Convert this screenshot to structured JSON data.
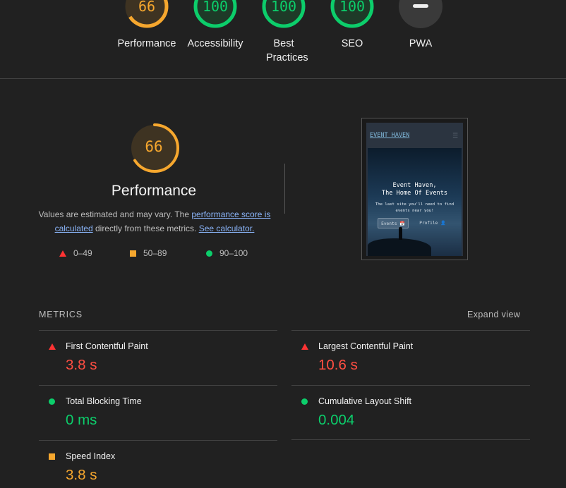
{
  "top_scores": [
    {
      "label": "Performance",
      "score": "66",
      "score_fraction": 0.66,
      "color": "#f6a72e",
      "track": "#3e3322"
    },
    {
      "label": "Accessibility",
      "score": "100",
      "score_fraction": 1.0,
      "color": "#0cce6b",
      "track": "#1e3a28"
    },
    {
      "label": "Best Practices",
      "score": "100",
      "score_fraction": 1.0,
      "color": "#0cce6b",
      "track": "#1e3a28"
    },
    {
      "label": "SEO",
      "score": "100",
      "score_fraction": 1.0,
      "color": "#0cce6b",
      "track": "#1e3a28"
    },
    {
      "label": "PWA",
      "score": "",
      "score_fraction": 0,
      "color": "#3a3a3a",
      "track": "#3a3a3a"
    }
  ],
  "performance": {
    "score": "66",
    "score_fraction": 0.66,
    "title": "Performance",
    "desc_prefix": "Values are estimated and may vary. The ",
    "desc_link1": "performance score is calculated",
    "desc_middle": " directly from these metrics. ",
    "desc_link2": "See calculator."
  },
  "legend": {
    "fail": "0–49",
    "average": "50–89",
    "pass": "90–100"
  },
  "thumbnail": {
    "brand": "EVENT HAVEN",
    "menu_icon": "hamburger-icon",
    "hero_title_line1": "Event Haven,",
    "hero_title_line2": "The Home Of Events",
    "hero_text": "The last site you'll need to find events near you!",
    "btn_events": "Events 📅",
    "btn_profile": "Profile 👤"
  },
  "metrics_section": {
    "heading": "METRICS",
    "expand_label": "Expand view"
  },
  "metrics": [
    {
      "name": "First Contentful Paint",
      "value": "3.8 s",
      "status": "fail"
    },
    {
      "name": "Largest Contentful Paint",
      "value": "10.6 s",
      "status": "fail"
    },
    {
      "name": "Total Blocking Time",
      "value": "0 ms",
      "status": "pass"
    },
    {
      "name": "Cumulative Layout Shift",
      "value": "0.004",
      "status": "pass"
    },
    {
      "name": "Speed Index",
      "value": "3.8 s",
      "status": "average"
    }
  ],
  "colors": {
    "fail": "#ff4e42",
    "average": "#f6a72e",
    "pass": "#0cce6b",
    "background": "#212121"
  }
}
